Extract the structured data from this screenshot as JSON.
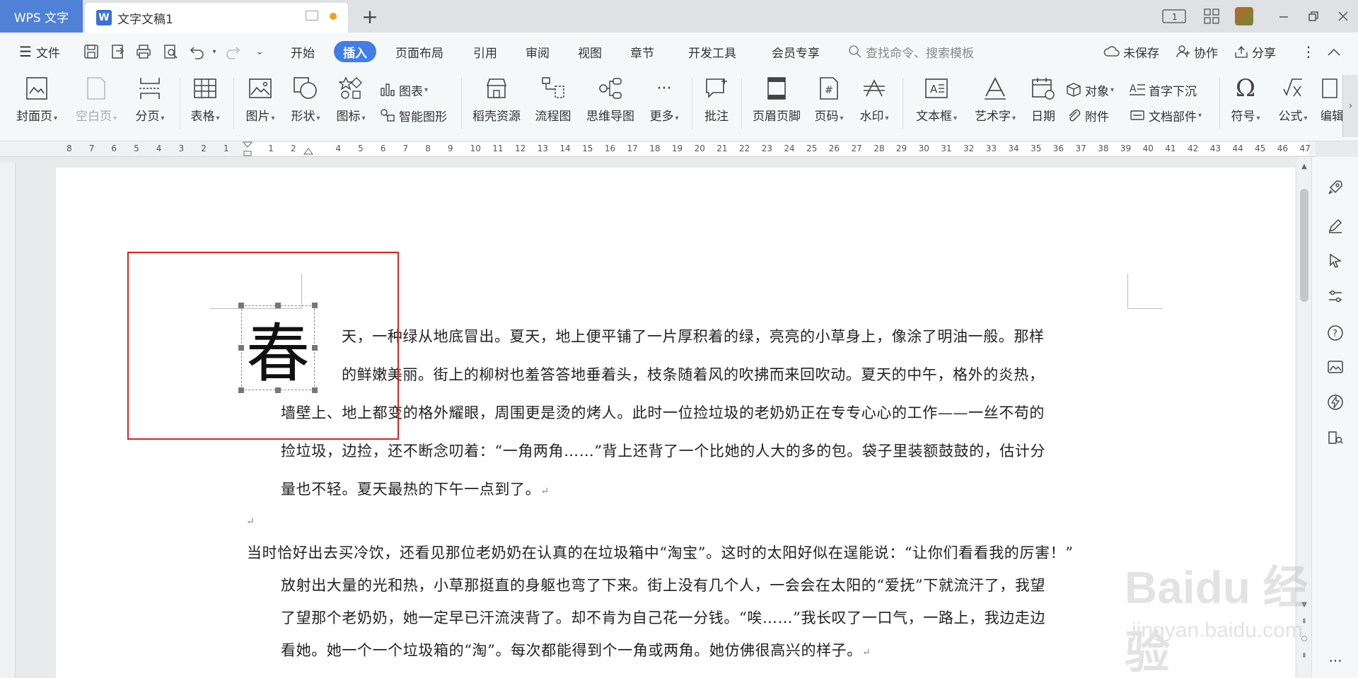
{
  "titlebar": {
    "app_name": "WPS 文字",
    "doc_icon_letter": "W",
    "doc_tab_title": "文字文稿1",
    "new_tab": "+",
    "layout_badge": "1"
  },
  "menu": {
    "file": "文件",
    "tabs": [
      "开始",
      "插入",
      "页面布局",
      "引用",
      "审阅",
      "视图",
      "章节",
      "开发工具",
      "会员专享"
    ],
    "active_tab": "插入",
    "search_placeholder": "查找命令、搜索模板",
    "unsaved": "未保存",
    "collaborate": "协作",
    "share": "分享"
  },
  "ribbon": {
    "cover_page": "封面页",
    "blank_page": "空白页",
    "page_break": "分页",
    "table": "表格",
    "picture": "图片",
    "shape": "形状",
    "icon": "图标",
    "chart": "图表",
    "smart_art": "智能图形",
    "docer": "稻壳资源",
    "flowchart": "流程图",
    "mindmap": "思维导图",
    "more": "更多",
    "comment": "批注",
    "header_footer": "页眉页脚",
    "page_number": "页码",
    "watermark": "水印",
    "textbox": "文本框",
    "wordart": "艺术字",
    "date": "日期",
    "object": "对象",
    "attachment": "附件",
    "drop_cap": "首字下沉",
    "doc_parts": "文档部件",
    "symbol": "符号",
    "formula": "公式",
    "edit": "编辑"
  },
  "ruler": {
    "ticks": [
      "8",
      "7",
      "6",
      "5",
      "4",
      "3",
      "2",
      "1",
      "",
      "1",
      "2",
      "",
      "4",
      "5",
      "6",
      "7",
      "8",
      "9",
      "10",
      "11",
      "12",
      "13",
      "14",
      "15",
      "16",
      "17",
      "18",
      "19",
      "20",
      "21",
      "22",
      "23",
      "24",
      "25",
      "26",
      "27",
      "28",
      "29",
      "30",
      "31",
      "32",
      "33",
      "34",
      "35",
      "36",
      "37",
      "38",
      "39",
      "40",
      "41",
      "42",
      "43",
      "44",
      "45",
      "46",
      "47"
    ]
  },
  "document": {
    "drop_cap_char": "春",
    "lines": [
      "天，一种绿从地底冒出。夏天，地上便平铺了一片厚积着的绿，亮亮的小草身上，像涂了明油一般。那样",
      "的鲜嫩美丽。街上的柳树也羞答答地垂着头，枝条随着风的吹拂而来回吹动。夏天的中午，格外的炎热，",
      "墙壁上、地上都变的格外耀眼，周围更是烫的烤人。此时一位捡垃圾的老奶奶正在专专心心的工作——一丝不苟的",
      "捡垃圾，边捡，还不断念叨着：“一角两角……”背上还背了一个比她的人大的多的包。袋子里装额鼓鼓的，估计分",
      "量也不轻。夏天最热的下午一点到了。",
      "当时恰好出去买冷饮，还看见那位老奶奶在认真的在垃圾箱中“淘宝”。这时的太阳好似在逞能说：“让你们看看我的厉害！”",
      "放射出大量的光和热，小草那挺直的身躯也弯了下来。街上没有几个人，一会会在太阳的“爱抚”下就流汗了，我望",
      "了望那个老奶奶，她一定早已汗流浃背了。却不肯为自己花一分钱。“唉……”我长叹了一口气，一路上，我边走边",
      "看她。她一个一个垃圾箱的“淘”。每次都能得到个一角或两角。她仿佛很高兴的样子。"
    ],
    "para_mark": "↵"
  },
  "watermark": {
    "brand": "Baidu 经验",
    "url": "jingyan.baidu.com"
  },
  "colors": {
    "accent": "#3f7ee8",
    "app_tab": "#4f81d6",
    "highlight_box": "#e02020"
  }
}
